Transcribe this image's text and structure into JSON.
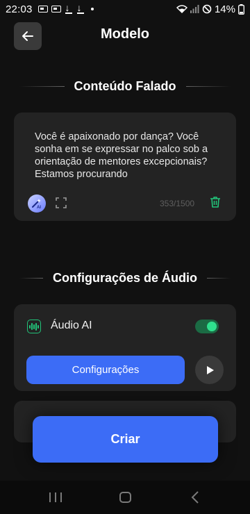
{
  "status_bar": {
    "time": "22:03",
    "battery": "14%"
  },
  "header": {
    "title": "Modelo"
  },
  "spoken_content": {
    "section_title": "Conteúdo Falado",
    "text": "Você é apaixonado por dança? Você sonha em se expressar no palco sob a orientação de mentores excepcionais? Estamos procurando",
    "char_count": "353/1500"
  },
  "audio_settings": {
    "section_title": "Configurações de Áudio",
    "audio_ai_label": "Áudio AI",
    "audio_ai_enabled": true,
    "config_button_label": "Configurações"
  },
  "create_button_label": "Criar",
  "colors": {
    "background": "#111111",
    "card": "#232323",
    "accent_blue": "#3c6cf6",
    "accent_green": "#22c47a"
  }
}
